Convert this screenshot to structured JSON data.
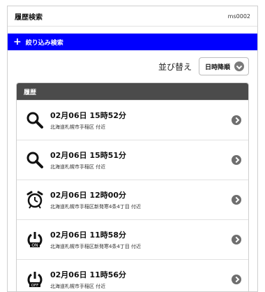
{
  "header": {
    "title": "履歴検索",
    "screen_id": "ms0002"
  },
  "narrow_search": {
    "label": "絞り込み検索",
    "icon": "plus-icon",
    "color": "#0000ff"
  },
  "sort": {
    "label": "並び替え",
    "selected": "日時降順"
  },
  "history": {
    "heading": "履歴",
    "items": [
      {
        "icon": "search-icon",
        "datetime": "02月06日 15時52分",
        "address": "北海道札幌市手稲区 付近"
      },
      {
        "icon": "search-icon",
        "datetime": "02月06日 15時51分",
        "address": "北海道札幌市手稲区 付近"
      },
      {
        "icon": "alarm-clock-icon",
        "datetime": "02月06日 12時00分",
        "address": "北海道札幌市手稲区新発寒4条4丁目 付近"
      },
      {
        "icon": "power-on-icon",
        "datetime": "02月06日 11時58分",
        "address": "北海道札幌市手稲区新発寒4条4丁目 付近"
      },
      {
        "icon": "power-off-icon",
        "datetime": "02月06日 11時56分",
        "address": "北海道札幌市手稲区 付近"
      }
    ]
  }
}
